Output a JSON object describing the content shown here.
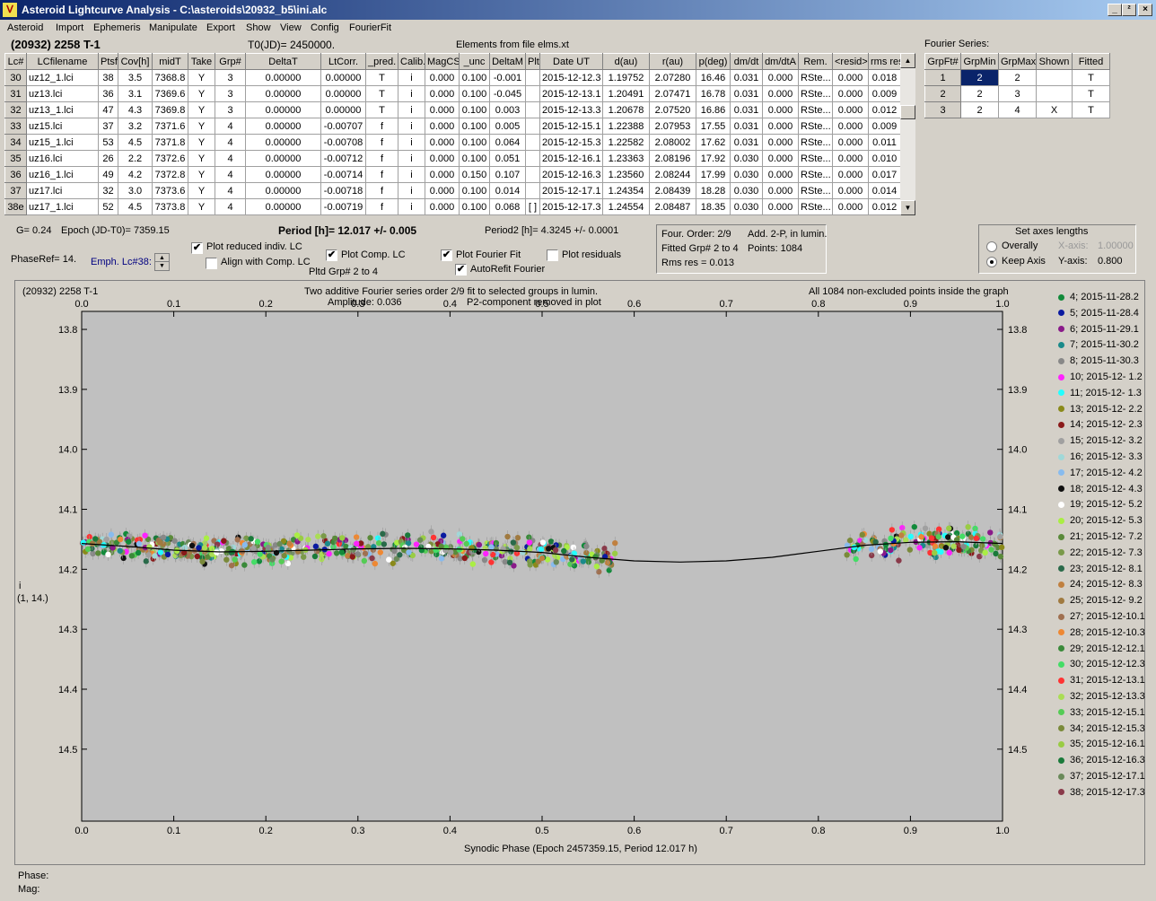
{
  "window": {
    "title": "Asteroid Lightcurve Analysis - C:\\asteroids\\20932_b5\\ini.alc",
    "icon": "app-icon",
    "controls": [
      "_",
      "²",
      "×"
    ]
  },
  "menu": [
    "Asteroid",
    "Import",
    "Ephemeris",
    "Manipulate",
    "Export",
    "Show",
    "View",
    "Config",
    "FourierFit"
  ],
  "header": {
    "asteroid": "(20932) 2258 T-1",
    "t0": "T0(JD)= 2450000.",
    "elements": "Elements from file elms.xt",
    "fourier_label": "Fourier Series:"
  },
  "lc_table": {
    "columns": [
      "Lc#",
      "LCfilename",
      "Ptsf",
      "Cov[h]",
      "midT",
      "Take",
      "Grp#",
      "DeltaT",
      "LtCorr.",
      "_pred.",
      "Calib.",
      "MagCS",
      "_unc",
      "DeltaM",
      "Plt",
      "Date UT",
      "d(au)",
      "r(au)",
      "p(deg)",
      "dm/dt",
      "dm/dtA",
      "Rem.",
      "<resid>",
      "rms res"
    ],
    "rows": [
      [
        "30",
        "uz12_1.lci",
        "38",
        "3.5",
        "7368.8",
        "Y",
        "3",
        "0.00000",
        "0.00000",
        "T",
        "i",
        "0.000",
        "0.100",
        "-0.001",
        "",
        "2015-12-12.3",
        "1.19752",
        "2.07280",
        "16.46",
        "0.031",
        "0.000",
        "RSte...",
        "0.000",
        "0.018"
      ],
      [
        "31",
        "uz13.lci",
        "36",
        "3.1",
        "7369.6",
        "Y",
        "3",
        "0.00000",
        "0.00000",
        "T",
        "i",
        "0.000",
        "0.100",
        "-0.045",
        "",
        "2015-12-13.1",
        "1.20491",
        "2.07471",
        "16.78",
        "0.031",
        "0.000",
        "RSte...",
        "0.000",
        "0.009"
      ],
      [
        "32",
        "uz13_1.lci",
        "47",
        "4.3",
        "7369.8",
        "Y",
        "3",
        "0.00000",
        "0.00000",
        "T",
        "i",
        "0.000",
        "0.100",
        "0.003",
        "",
        "2015-12-13.3",
        "1.20678",
        "2.07520",
        "16.86",
        "0.031",
        "0.000",
        "RSte...",
        "0.000",
        "0.012"
      ],
      [
        "33",
        "uz15.lci",
        "37",
        "3.2",
        "7371.6",
        "Y",
        "4",
        "0.00000",
        "-0.00707",
        "f",
        "i",
        "0.000",
        "0.100",
        "0.005",
        "",
        "2015-12-15.1",
        "1.22388",
        "2.07953",
        "17.55",
        "0.031",
        "0.000",
        "RSte...",
        "0.000",
        "0.009"
      ],
      [
        "34",
        "uz15_1.lci",
        "53",
        "4.5",
        "7371.8",
        "Y",
        "4",
        "0.00000",
        "-0.00708",
        "f",
        "i",
        "0.000",
        "0.100",
        "0.064",
        "",
        "2015-12-15.3",
        "1.22582",
        "2.08002",
        "17.62",
        "0.031",
        "0.000",
        "RSte...",
        "0.000",
        "0.011"
      ],
      [
        "35",
        "uz16.lci",
        "26",
        "2.2",
        "7372.6",
        "Y",
        "4",
        "0.00000",
        "-0.00712",
        "f",
        "i",
        "0.000",
        "0.100",
        "0.051",
        "",
        "2015-12-16.1",
        "1.23363",
        "2.08196",
        "17.92",
        "0.030",
        "0.000",
        "RSte...",
        "0.000",
        "0.010"
      ],
      [
        "36",
        "uz16_1.lci",
        "49",
        "4.2",
        "7372.8",
        "Y",
        "4",
        "0.00000",
        "-0.00714",
        "f",
        "i",
        "0.000",
        "0.150",
        "0.107",
        "",
        "2015-12-16.3",
        "1.23560",
        "2.08244",
        "17.99",
        "0.030",
        "0.000",
        "RSte...",
        "0.000",
        "0.017"
      ],
      [
        "37",
        "uz17.lci",
        "32",
        "3.0",
        "7373.6",
        "Y",
        "4",
        "0.00000",
        "-0.00718",
        "f",
        "i",
        "0.000",
        "0.100",
        "0.014",
        "",
        "2015-12-17.1",
        "1.24354",
        "2.08439",
        "18.28",
        "0.030",
        "0.000",
        "RSte...",
        "0.000",
        "0.014"
      ],
      [
        "38e",
        "uz17_1.lci",
        "52",
        "4.5",
        "7373.8",
        "Y",
        "4",
        "0.00000",
        "-0.00719",
        "f",
        "i",
        "0.000",
        "0.100",
        "0.068",
        "[ ]",
        "2015-12-17.3",
        "1.24554",
        "2.08487",
        "18.35",
        "0.030",
        "0.000",
        "RSte...",
        "0.000",
        "0.012"
      ]
    ]
  },
  "fourier_table": {
    "columns": [
      "GrpFt#",
      "GrpMin",
      "GrpMax",
      "Shown",
      "Fitted"
    ],
    "rows": [
      [
        "1",
        "2",
        "2",
        "",
        "T"
      ],
      [
        "2",
        "2",
        "3",
        "",
        "T"
      ],
      [
        "3",
        "2",
        "4",
        "X",
        "T"
      ]
    ]
  },
  "controls": {
    "g": "G= 0.24",
    "epoch": "Epoch (JD-T0)= 7359.15",
    "period": "Period [h]= 12.017 +/- 0.005",
    "period2": "Period2 [h]= 4.3245 +/- 0.0001",
    "phaseref": "PhaseRef= 14.",
    "emph": "Emph. Lc#38:",
    "plot_reduced": "Plot reduced indiv. LC",
    "align": "Align with Comp. LC",
    "plot_comp": "Plot Comp. LC",
    "pltd_grp": "Pltd Grp#  2   to    4",
    "plot_fourier": "Plot Fourier Fit",
    "autorefit": "AutoRefit Fourier",
    "plot_residuals": "Plot residuals",
    "check": "✔"
  },
  "fit_info": {
    "order": "Four. Order:  2/9",
    "add": "Add. 2-P, in lumin.",
    "fitted": "Fitted Grp# 2 to 4",
    "points": "Points: 1084",
    "rms": "Rms res     = 0.013"
  },
  "axes_panel": {
    "title": "Set axes lengths",
    "overally": "Overally",
    "keep": "Keep Axis",
    "xlabel": "X-axis:",
    "xval": "1.00000",
    "ylabel": "Y-axis:",
    "yval": "0.800"
  },
  "plot": {
    "title_left": "(20932) 2258 T-1",
    "title_center1": "Two additive Fourier series order 2/9 fit to selected groups in lumin.",
    "title_center2a": "Amplitude: 0.036",
    "title_center2b": "P2-component removed in plot",
    "title_right": "All 1084 non-excluded points inside the graph",
    "ylabel1": "i",
    "ylabel2": "(1, 14.)",
    "xlabel": "Synodic Phase (Epoch 2457359.15, Period 12.017 h)"
  },
  "chart_data": {
    "type": "scatter",
    "x_range": [
      0,
      1
    ],
    "y_range": [
      14.62,
      13.77
    ],
    "y_inverted": true,
    "x_ticks": [
      "0.0",
      "0.1",
      "0.2",
      "0.3",
      "0.4",
      "0.5",
      "0.6",
      "0.7",
      "0.8",
      "0.9",
      "1.0"
    ],
    "y_ticks": [
      "13.8",
      "13.9",
      "14.0",
      "14.1",
      "14.2",
      "14.3",
      "14.4",
      "14.5"
    ],
    "fit_curve": {
      "x": [
        0,
        0.05,
        0.1,
        0.15,
        0.2,
        0.25,
        0.3,
        0.35,
        0.4,
        0.45,
        0.5,
        0.55,
        0.6,
        0.65,
        0.7,
        0.75,
        0.8,
        0.85,
        0.9,
        0.95,
        1.0
      ],
      "y": [
        14.157,
        14.162,
        14.168,
        14.171,
        14.17,
        14.168,
        14.166,
        14.165,
        14.166,
        14.168,
        14.172,
        14.18,
        14.186,
        14.188,
        14.186,
        14.18,
        14.17,
        14.16,
        14.155,
        14.154,
        14.157
      ]
    },
    "point_phase_ranges": [
      [
        0.0,
        0.58
      ],
      [
        0.83,
        1.0
      ]
    ],
    "series": [
      {
        "name": "4; 2015-11-28.2",
        "color": "#118a3a"
      },
      {
        "name": "5; 2015-11-28.4",
        "color": "#0a1aa0"
      },
      {
        "name": "6; 2015-11-29.1",
        "color": "#8a1a8a"
      },
      {
        "name": "7; 2015-11-30.2",
        "color": "#1a8a8a"
      },
      {
        "name": "8; 2015-11-30.3",
        "color": "#888888"
      },
      {
        "name": "10; 2015-12- 1.2",
        "color": "#ff22ff"
      },
      {
        "name": "11; 2015-12- 1.3",
        "color": "#22ffff"
      },
      {
        "name": "13; 2015-12- 2.2",
        "color": "#8a8a1a"
      },
      {
        "name": "14; 2015-12- 2.3",
        "color": "#8a1a1a"
      },
      {
        "name": "15; 2015-12- 3.2",
        "color": "#a0a0a0"
      },
      {
        "name": "16; 2015-12- 3.3",
        "color": "#a0d8d8"
      },
      {
        "name": "17; 2015-12- 4.2",
        "color": "#88bbee"
      },
      {
        "name": "18; 2015-12- 4.3",
        "color": "#101010"
      },
      {
        "name": "19; 2015-12- 5.2",
        "color": "#ffffff"
      },
      {
        "name": "20; 2015-12- 5.3",
        "color": "#aaee44"
      },
      {
        "name": "21; 2015-12- 7.2",
        "color": "#5a8a3a"
      },
      {
        "name": "22; 2015-12- 7.3",
        "color": "#7a9a4a"
      },
      {
        "name": "23; 2015-12- 8.1",
        "color": "#2a6a4a"
      },
      {
        "name": "24; 2015-12- 8.3",
        "color": "#c08040"
      },
      {
        "name": "25; 2015-12- 9.2",
        "color": "#a07a40"
      },
      {
        "name": "27; 2015-12-10.1",
        "color": "#a07050"
      },
      {
        "name": "28; 2015-12-10.3",
        "color": "#ee8833"
      },
      {
        "name": "29; 2015-12-12.1",
        "color": "#3a8a3a"
      },
      {
        "name": "30; 2015-12-12.3",
        "color": "#44dd66"
      },
      {
        "name": "31; 2015-12-13.1",
        "color": "#ff3333"
      },
      {
        "name": "32; 2015-12-13.3",
        "color": "#aadd55"
      },
      {
        "name": "33; 2015-12-15.1",
        "color": "#55cc55"
      },
      {
        "name": "34; 2015-12-15.3",
        "color": "#7a8a3a"
      },
      {
        "name": "35; 2015-12-16.1",
        "color": "#99cc44"
      },
      {
        "name": "36; 2015-12-16.3",
        "color": "#1a7a3a"
      },
      {
        "name": "37; 2015-12-17.1",
        "color": "#6a8a5a"
      },
      {
        "name": "38; 2015-12-17.3",
        "color": "#8a3a4a"
      }
    ]
  },
  "status": {
    "phase": "Phase:",
    "mag": "Mag:"
  }
}
